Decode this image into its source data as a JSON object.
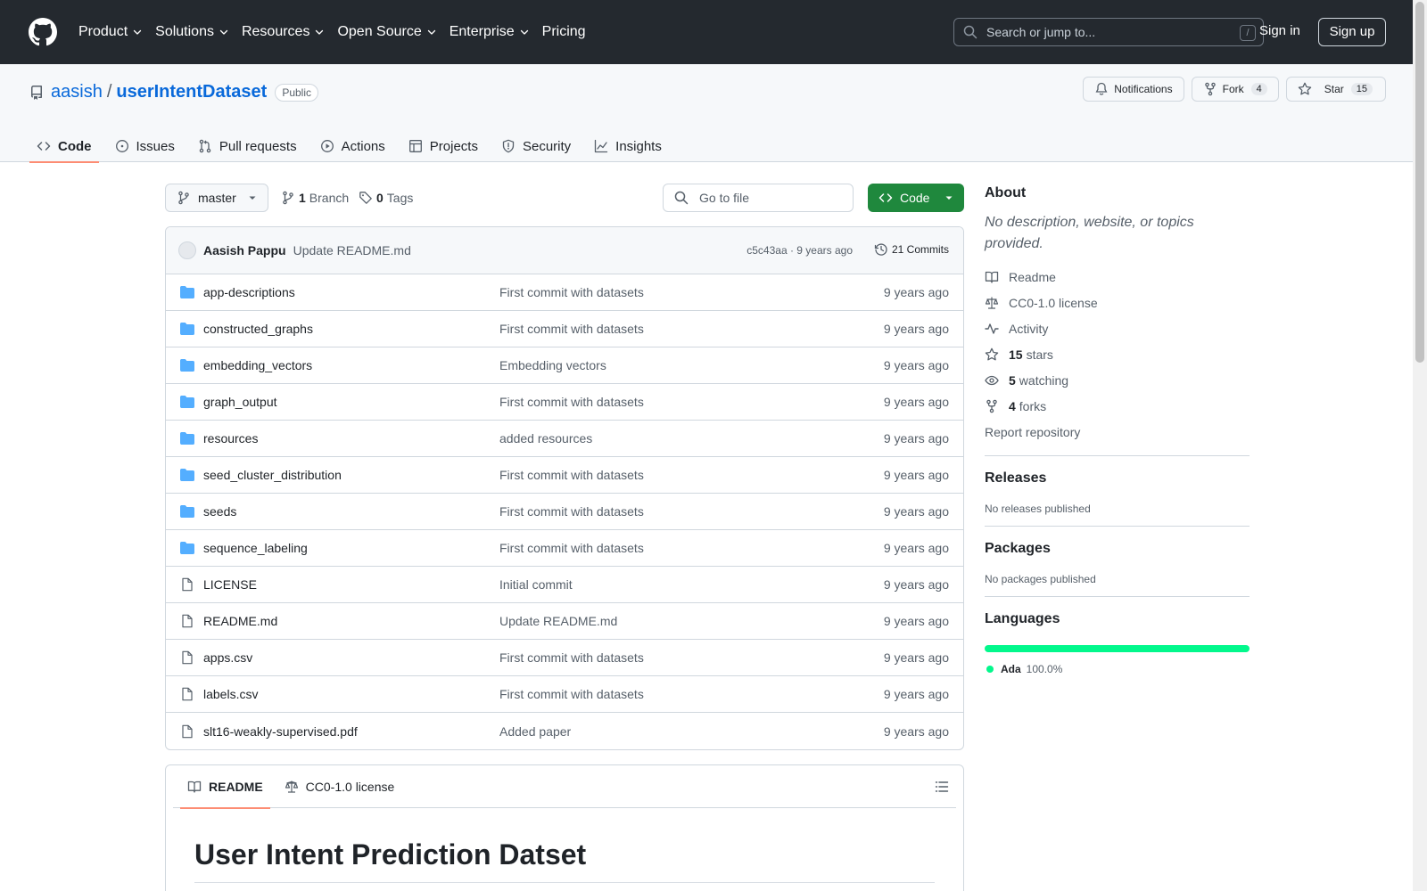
{
  "header": {
    "nav": [
      {
        "label": "Product",
        "dropdown": true
      },
      {
        "label": "Solutions",
        "dropdown": true
      },
      {
        "label": "Resources",
        "dropdown": true
      },
      {
        "label": "Open Source",
        "dropdown": true
      },
      {
        "label": "Enterprise",
        "dropdown": true
      },
      {
        "label": "Pricing",
        "dropdown": false
      }
    ],
    "search_placeholder": "Search or jump to...",
    "search_shortcut": "/",
    "sign_in": "Sign in",
    "sign_up": "Sign up"
  },
  "repo": {
    "owner": "aasish",
    "separator": "/",
    "name": "userIntentDataset",
    "visibility": "Public",
    "notifications_label": "Notifications",
    "fork_label": "Fork",
    "fork_count": "4",
    "star_label": "Star",
    "star_count": "15"
  },
  "tabs": [
    {
      "label": "Code",
      "icon": "code-icon",
      "active": true
    },
    {
      "label": "Issues",
      "icon": "issue-icon",
      "active": false
    },
    {
      "label": "Pull requests",
      "icon": "pull-request-icon",
      "active": false
    },
    {
      "label": "Actions",
      "icon": "play-icon",
      "active": false
    },
    {
      "label": "Projects",
      "icon": "table-icon",
      "active": false
    },
    {
      "label": "Security",
      "icon": "shield-icon",
      "active": false
    },
    {
      "label": "Insights",
      "icon": "graph-icon",
      "active": false
    }
  ],
  "browser": {
    "branch": "master",
    "branch_count": "1",
    "branch_label": "Branch",
    "tag_count": "0",
    "tag_label": "Tags",
    "goto_placeholder": "Go to file",
    "code_button": "Code"
  },
  "latest_commit": {
    "author": "Aasish Pappu",
    "message": "Update README.md",
    "meta": "c5c43aa · 9 years ago",
    "commits_label": "21 Commits"
  },
  "files": [
    {
      "name": "app-descriptions",
      "type": "folder",
      "commit": "First commit with datasets",
      "age": "9 years ago"
    },
    {
      "name": "constructed_graphs",
      "type": "folder",
      "commit": "First commit with datasets",
      "age": "9 years ago"
    },
    {
      "name": "embedding_vectors",
      "type": "folder",
      "commit": "Embedding vectors",
      "age": "9 years ago"
    },
    {
      "name": "graph_output",
      "type": "folder",
      "commit": "First commit with datasets",
      "age": "9 years ago"
    },
    {
      "name": "resources",
      "type": "folder",
      "commit": "added resources",
      "age": "9 years ago"
    },
    {
      "name": "seed_cluster_distribution",
      "type": "folder",
      "commit": "First commit with datasets",
      "age": "9 years ago"
    },
    {
      "name": "seeds",
      "type": "folder",
      "commit": "First commit with datasets",
      "age": "9 years ago"
    },
    {
      "name": "sequence_labeling",
      "type": "folder",
      "commit": "First commit with datasets",
      "age": "9 years ago"
    },
    {
      "name": "LICENSE",
      "type": "file",
      "commit": "Initial commit",
      "age": "9 years ago"
    },
    {
      "name": "README.md",
      "type": "file",
      "commit": "Update README.md",
      "age": "9 years ago"
    },
    {
      "name": "apps.csv",
      "type": "file",
      "commit": "First commit with datasets",
      "age": "9 years ago"
    },
    {
      "name": "labels.csv",
      "type": "file",
      "commit": "First commit with datasets",
      "age": "9 years ago"
    },
    {
      "name": "slt16-weakly-supervised.pdf",
      "type": "file",
      "commit": "Added paper",
      "age": "9 years ago"
    }
  ],
  "readme": {
    "tab_readme": "README",
    "tab_license": "CC0-1.0 license",
    "heading": "User Intent Prediction Datset"
  },
  "about": {
    "title": "About",
    "description": "No description, website, or topics provided.",
    "readme": "Readme",
    "license": "CC0-1.0 license",
    "activity": "Activity",
    "stars_count": "15",
    "stars_label": "stars",
    "watching_count": "5",
    "watching_label": "watching",
    "forks_count": "4",
    "forks_label": "forks",
    "report": "Report repository"
  },
  "releases": {
    "title": "Releases",
    "empty": "No releases published"
  },
  "packages": {
    "title": "Packages",
    "empty": "No packages published"
  },
  "languages": {
    "title": "Languages",
    "items": [
      {
        "name": "Ada",
        "percent": "100.0%",
        "color": "#02f88c",
        "fraction": 1.0
      }
    ]
  },
  "colors": {
    "header_bg": "#24292f",
    "accent_link": "#0969da",
    "primary_button": "#1f883d",
    "active_tab_underline": "#fd8c73",
    "folder_icon": "#54aeff"
  }
}
